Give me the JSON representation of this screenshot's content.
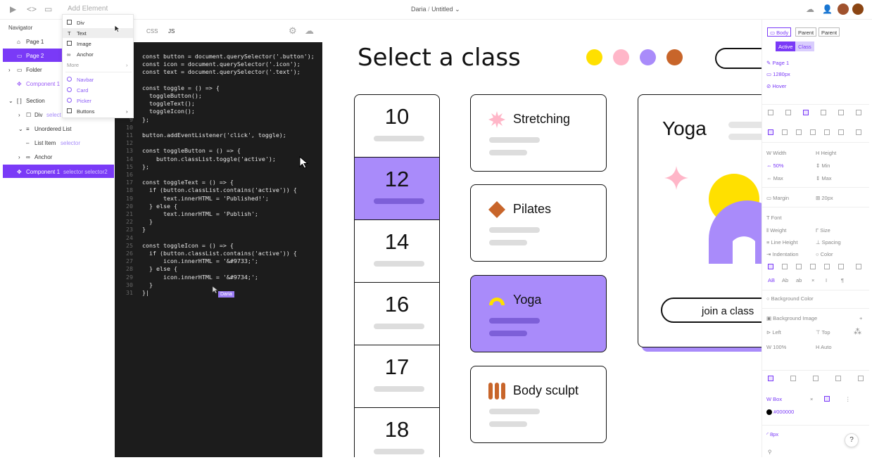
{
  "topbar": {
    "add_placeholder": "Add Element",
    "project_owner": "Daria",
    "project_sep": "/",
    "project_name": "Untitled",
    "avatar1_color": "#a0522d",
    "avatar2_color": "#8b4513"
  },
  "navigator": {
    "title": "Navigator",
    "items": [
      {
        "label": "Page 1",
        "icon": "home-icon"
      },
      {
        "label": "Page 2",
        "icon": "page-icon"
      },
      {
        "label": "Folder",
        "icon": "folder-icon"
      },
      {
        "label": "Component 1",
        "icon": "component-icon"
      },
      {
        "label": "Section",
        "icon": "section-icon"
      },
      {
        "label": "Div",
        "selector": "select"
      },
      {
        "label": "Unordered List"
      },
      {
        "label": "List Item",
        "selector": "selector"
      },
      {
        "label": "Anchor"
      },
      {
        "label": "Component 1",
        "selector": "selector  selector2"
      }
    ]
  },
  "dropdown": {
    "items": [
      "Div",
      "Text",
      "Image",
      "Anchor",
      "More"
    ],
    "components": [
      "Navbar",
      "Card",
      "Picker",
      "Buttons"
    ]
  },
  "editor": {
    "tab_css": "CSS",
    "tab_js": "JS",
    "cursor_user": "Daria",
    "lines": [
      "const button = document.querySelector('.button');",
      "const icon = document.querySelector('.icon');",
      "const text = document.querySelector('.text');",
      "",
      "const toggle = () => {",
      "  toggleButton();",
      "  toggleText();",
      "  toggleIcon();",
      "};",
      "",
      "button.addEventListener('click', toggle);",
      "",
      "const toggleButton = () => {",
      "    button.classList.toggle('active');",
      "};",
      "",
      "const toggleText = () => {",
      "  if (button.classList.contains('active')) {",
      "      text.innerHTML = 'Published!';",
      "  } else {",
      "      text.innerHTML = 'Publish';",
      "  }",
      "}",
      "",
      "const toggleIcon = () => {",
      "  if (button.classList.contains('active')) {",
      "      icon.innerHTML = '&#9733;';",
      "  } else {",
      "      icon.innerHTML = '&#9734;';",
      "  }",
      "}|"
    ]
  },
  "canvas": {
    "title": "Select a class",
    "dot_colors": [
      "#ffe000",
      "#ffb6c8",
      "#a98bfa",
      "#c8652a"
    ],
    "dates": [
      "10",
      "12",
      "14",
      "16",
      "17",
      "18"
    ],
    "active_date": "12",
    "classes": [
      {
        "name": "Stretching",
        "icon": "starburst-icon",
        "color": "#ffb6c8"
      },
      {
        "name": "Pilates",
        "icon": "diamond-icon",
        "color": "#c8652a"
      },
      {
        "name": "Yoga",
        "icon": "arch-icon",
        "color": "#ffe000"
      },
      {
        "name": "Body sculpt",
        "icon": "bars-icon",
        "color": "#c8652a"
      }
    ],
    "detail_title": "Yoga",
    "join_label": "join a class"
  },
  "panel": {
    "tabs": [
      "Body",
      "Parent",
      "Parent"
    ],
    "state_active": "Active",
    "state_class": "Class",
    "page": "Page 1",
    "breakpoint": "1280px",
    "hover": "Hover",
    "width_label": "Width",
    "height_label": "Height",
    "width_value": "50%",
    "min_label": "Min",
    "max_label": "Max",
    "max2_label": "Max",
    "margin_label": "Margin",
    "margin_value": "20px",
    "font_label": "Font",
    "weight_label": "Weight",
    "size_label": "Size",
    "lineheight_label": "Line Height",
    "spacing_label": "Spacing",
    "indent_label": "Indentation",
    "color_label": "Color",
    "bgcolor_label": "Background Color",
    "bgimage_label": "Background Image",
    "left_label": "Left",
    "top_label": "Top",
    "bg_width": "100%",
    "bg_auto": "Auto",
    "border_label": "Box",
    "border_color": "#000000",
    "radius_value": "8px",
    "text_ab": "AB",
    "text_ab2": "Ab",
    "text_ab3": "ab"
  }
}
